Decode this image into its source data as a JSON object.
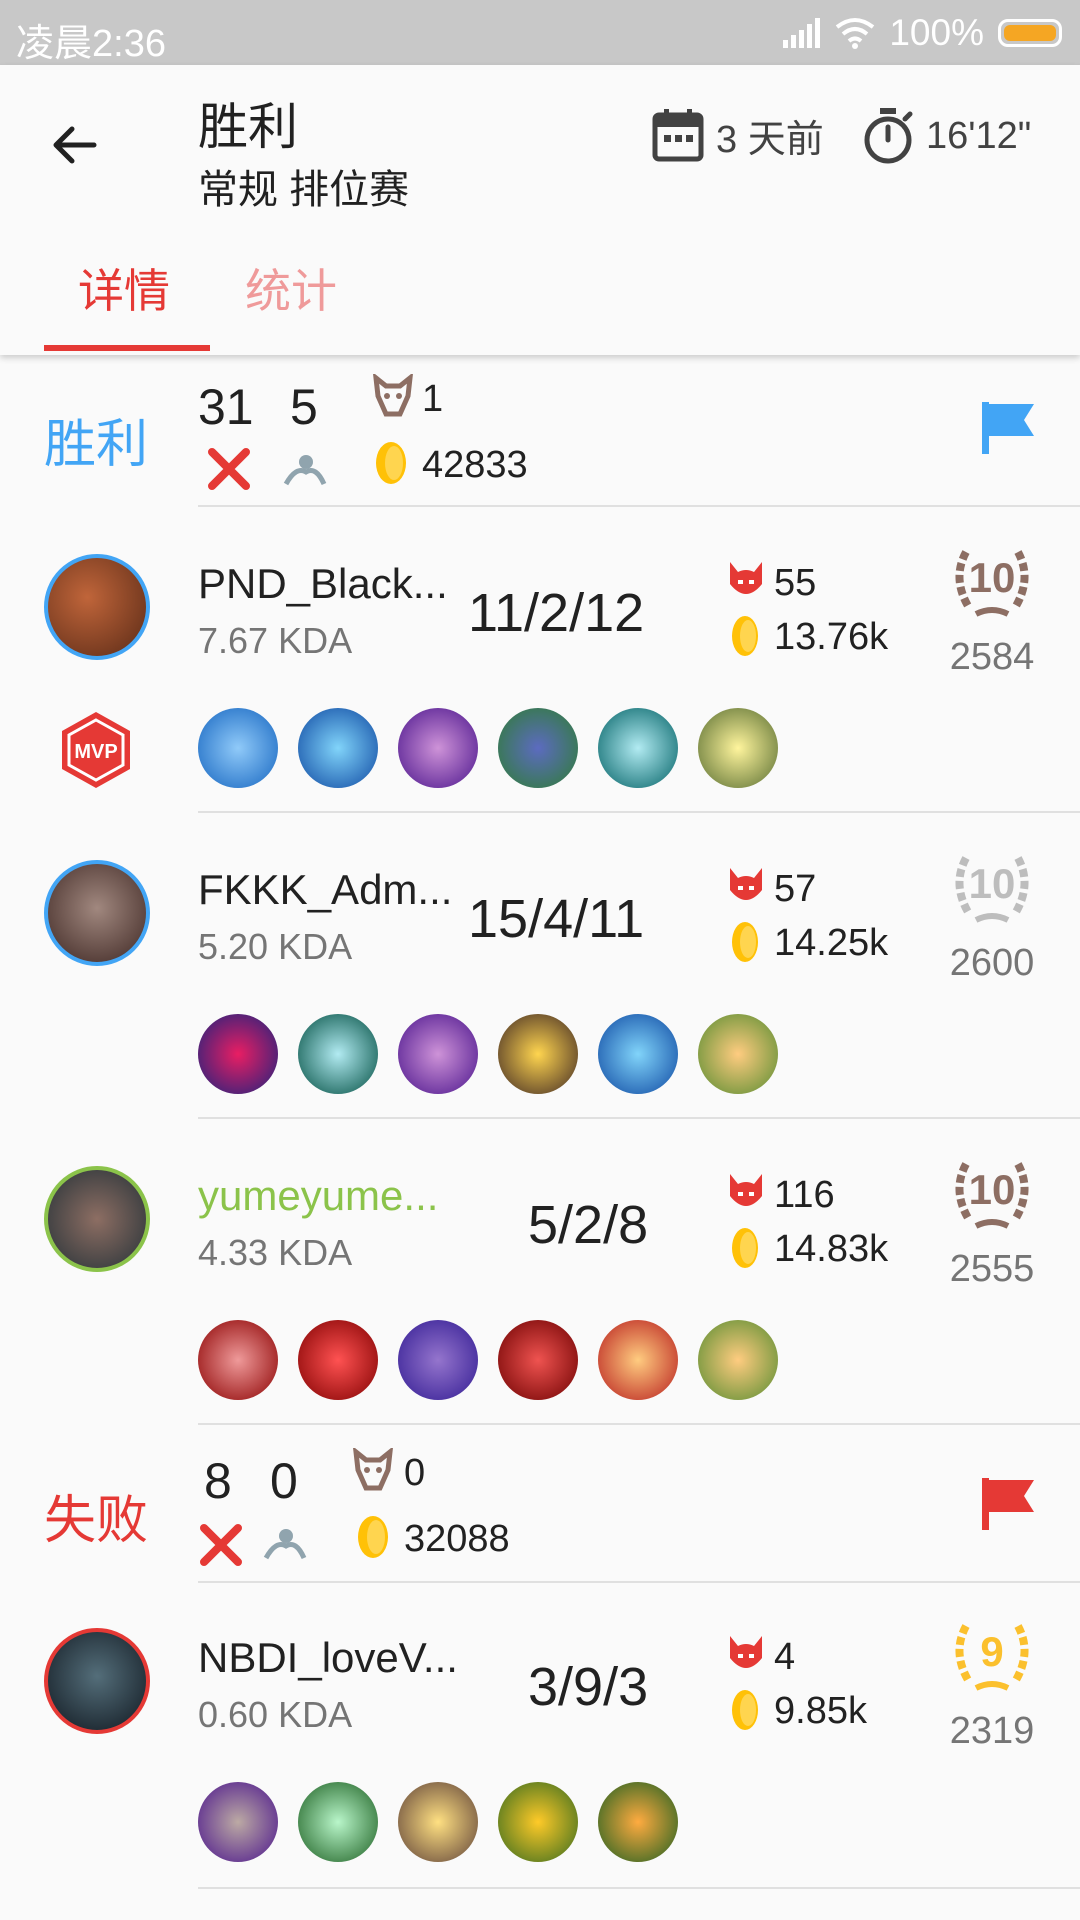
{
  "status_bar": {
    "time": "凌晨2:36",
    "battery": "100%"
  },
  "header": {
    "title": "胜利",
    "subtitle": "常规 排位赛",
    "date": "3 天前",
    "duration": "16'12\""
  },
  "tabs": [
    {
      "label": "详情"
    },
    {
      "label": "统计"
    }
  ],
  "teams": [
    {
      "label": "胜利",
      "color": "#42a5f5",
      "kills": "31",
      "assists": "5",
      "dragons": "1",
      "gold": "42833",
      "players": [
        {
          "name": "PND_Black...",
          "kda": "7.67 KDA",
          "score": "11/2/12",
          "minions": "55",
          "gold": "13.76k",
          "rank": "10",
          "rank_score": "2584",
          "mvp": true,
          "name_color": "#212121",
          "ring_color": "#42a5f5"
        },
        {
          "name": "FKKK_Adm...",
          "kda": "5.20 KDA",
          "score": "15/4/11",
          "minions": "57",
          "gold": "14.25k",
          "rank": "10",
          "rank_score": "2600",
          "mvp": false,
          "name_color": "#212121",
          "ring_color": "#42a5f5"
        },
        {
          "name": "yumeyume...",
          "kda": "4.33 KDA",
          "score": "5/2/8",
          "minions": "116",
          "gold": "14.83k",
          "rank": "10",
          "rank_score": "2555",
          "mvp": false,
          "name_color": "#8bc34a",
          "ring_color": "#8bc34a"
        }
      ]
    },
    {
      "label": "失败",
      "color": "#e53935",
      "kills": "8",
      "assists": "0",
      "dragons": "0",
      "gold": "32088",
      "players": [
        {
          "name": "NBDI_loveV...",
          "kda": "0.60 KDA",
          "score": "3/9/3",
          "minions": "4",
          "gold": "9.85k",
          "rank": "9",
          "rank_score": "2319",
          "mvp": false,
          "name_color": "#212121",
          "ring_color": "#e53935"
        }
      ]
    }
  ],
  "mvp_label": "MVP"
}
